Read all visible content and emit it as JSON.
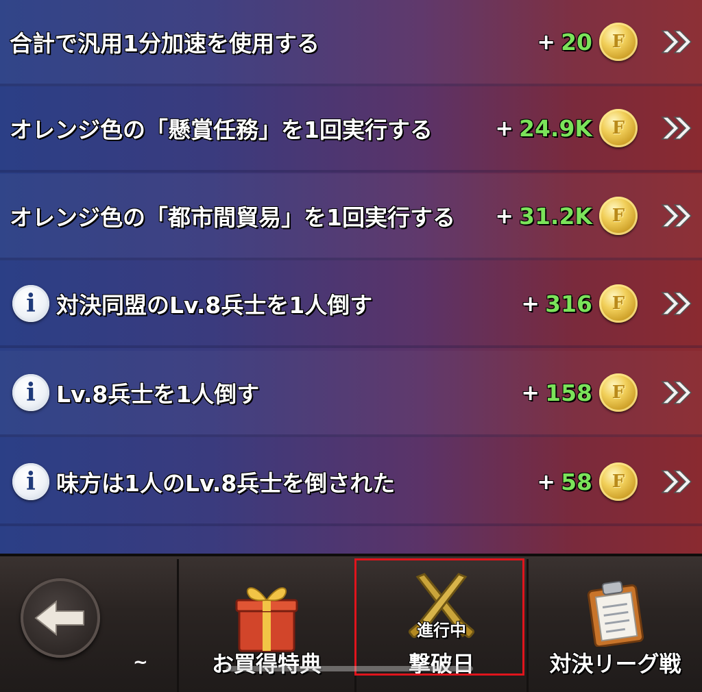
{
  "tasks": [
    {
      "text": "合計で汎用1分加速を使用する",
      "plus": "+",
      "points": "20",
      "has_info": false
    },
    {
      "text": "オレンジ色の「懸賞任務」を1回実行する",
      "plus": "+",
      "points": "24.9K",
      "has_info": false
    },
    {
      "text": "オレンジ色の「都市間貿易」を1回実行する",
      "plus": "+",
      "points": "31.2K",
      "has_info": false
    },
    {
      "text": "対決同盟のLv.8兵士を1人倒す",
      "plus": "+",
      "points": "316",
      "has_info": true
    },
    {
      "text": "Lv.8兵士を1人倒す",
      "plus": "+",
      "points": "158",
      "has_info": true
    },
    {
      "text": "味方は1人のLv.8兵士を倒された",
      "plus": "+",
      "points": "58",
      "has_info": true
    }
  ],
  "info_glyph": "i",
  "coin_glyph": "F",
  "bottom_nav": {
    "back_icon": "arrow-left-icon",
    "tilde": "~",
    "tabs": [
      {
        "label": "お買得特典",
        "icon": "gift-icon"
      },
      {
        "label": "撃破日",
        "badge": "進行中",
        "icon": "crossed-swords-icon",
        "highlighted": true
      },
      {
        "label": "対決リーグ戦",
        "icon": "clipboard-icon"
      }
    ]
  },
  "colors": {
    "points": "#7be35a",
    "highlight": "#e0141c"
  }
}
